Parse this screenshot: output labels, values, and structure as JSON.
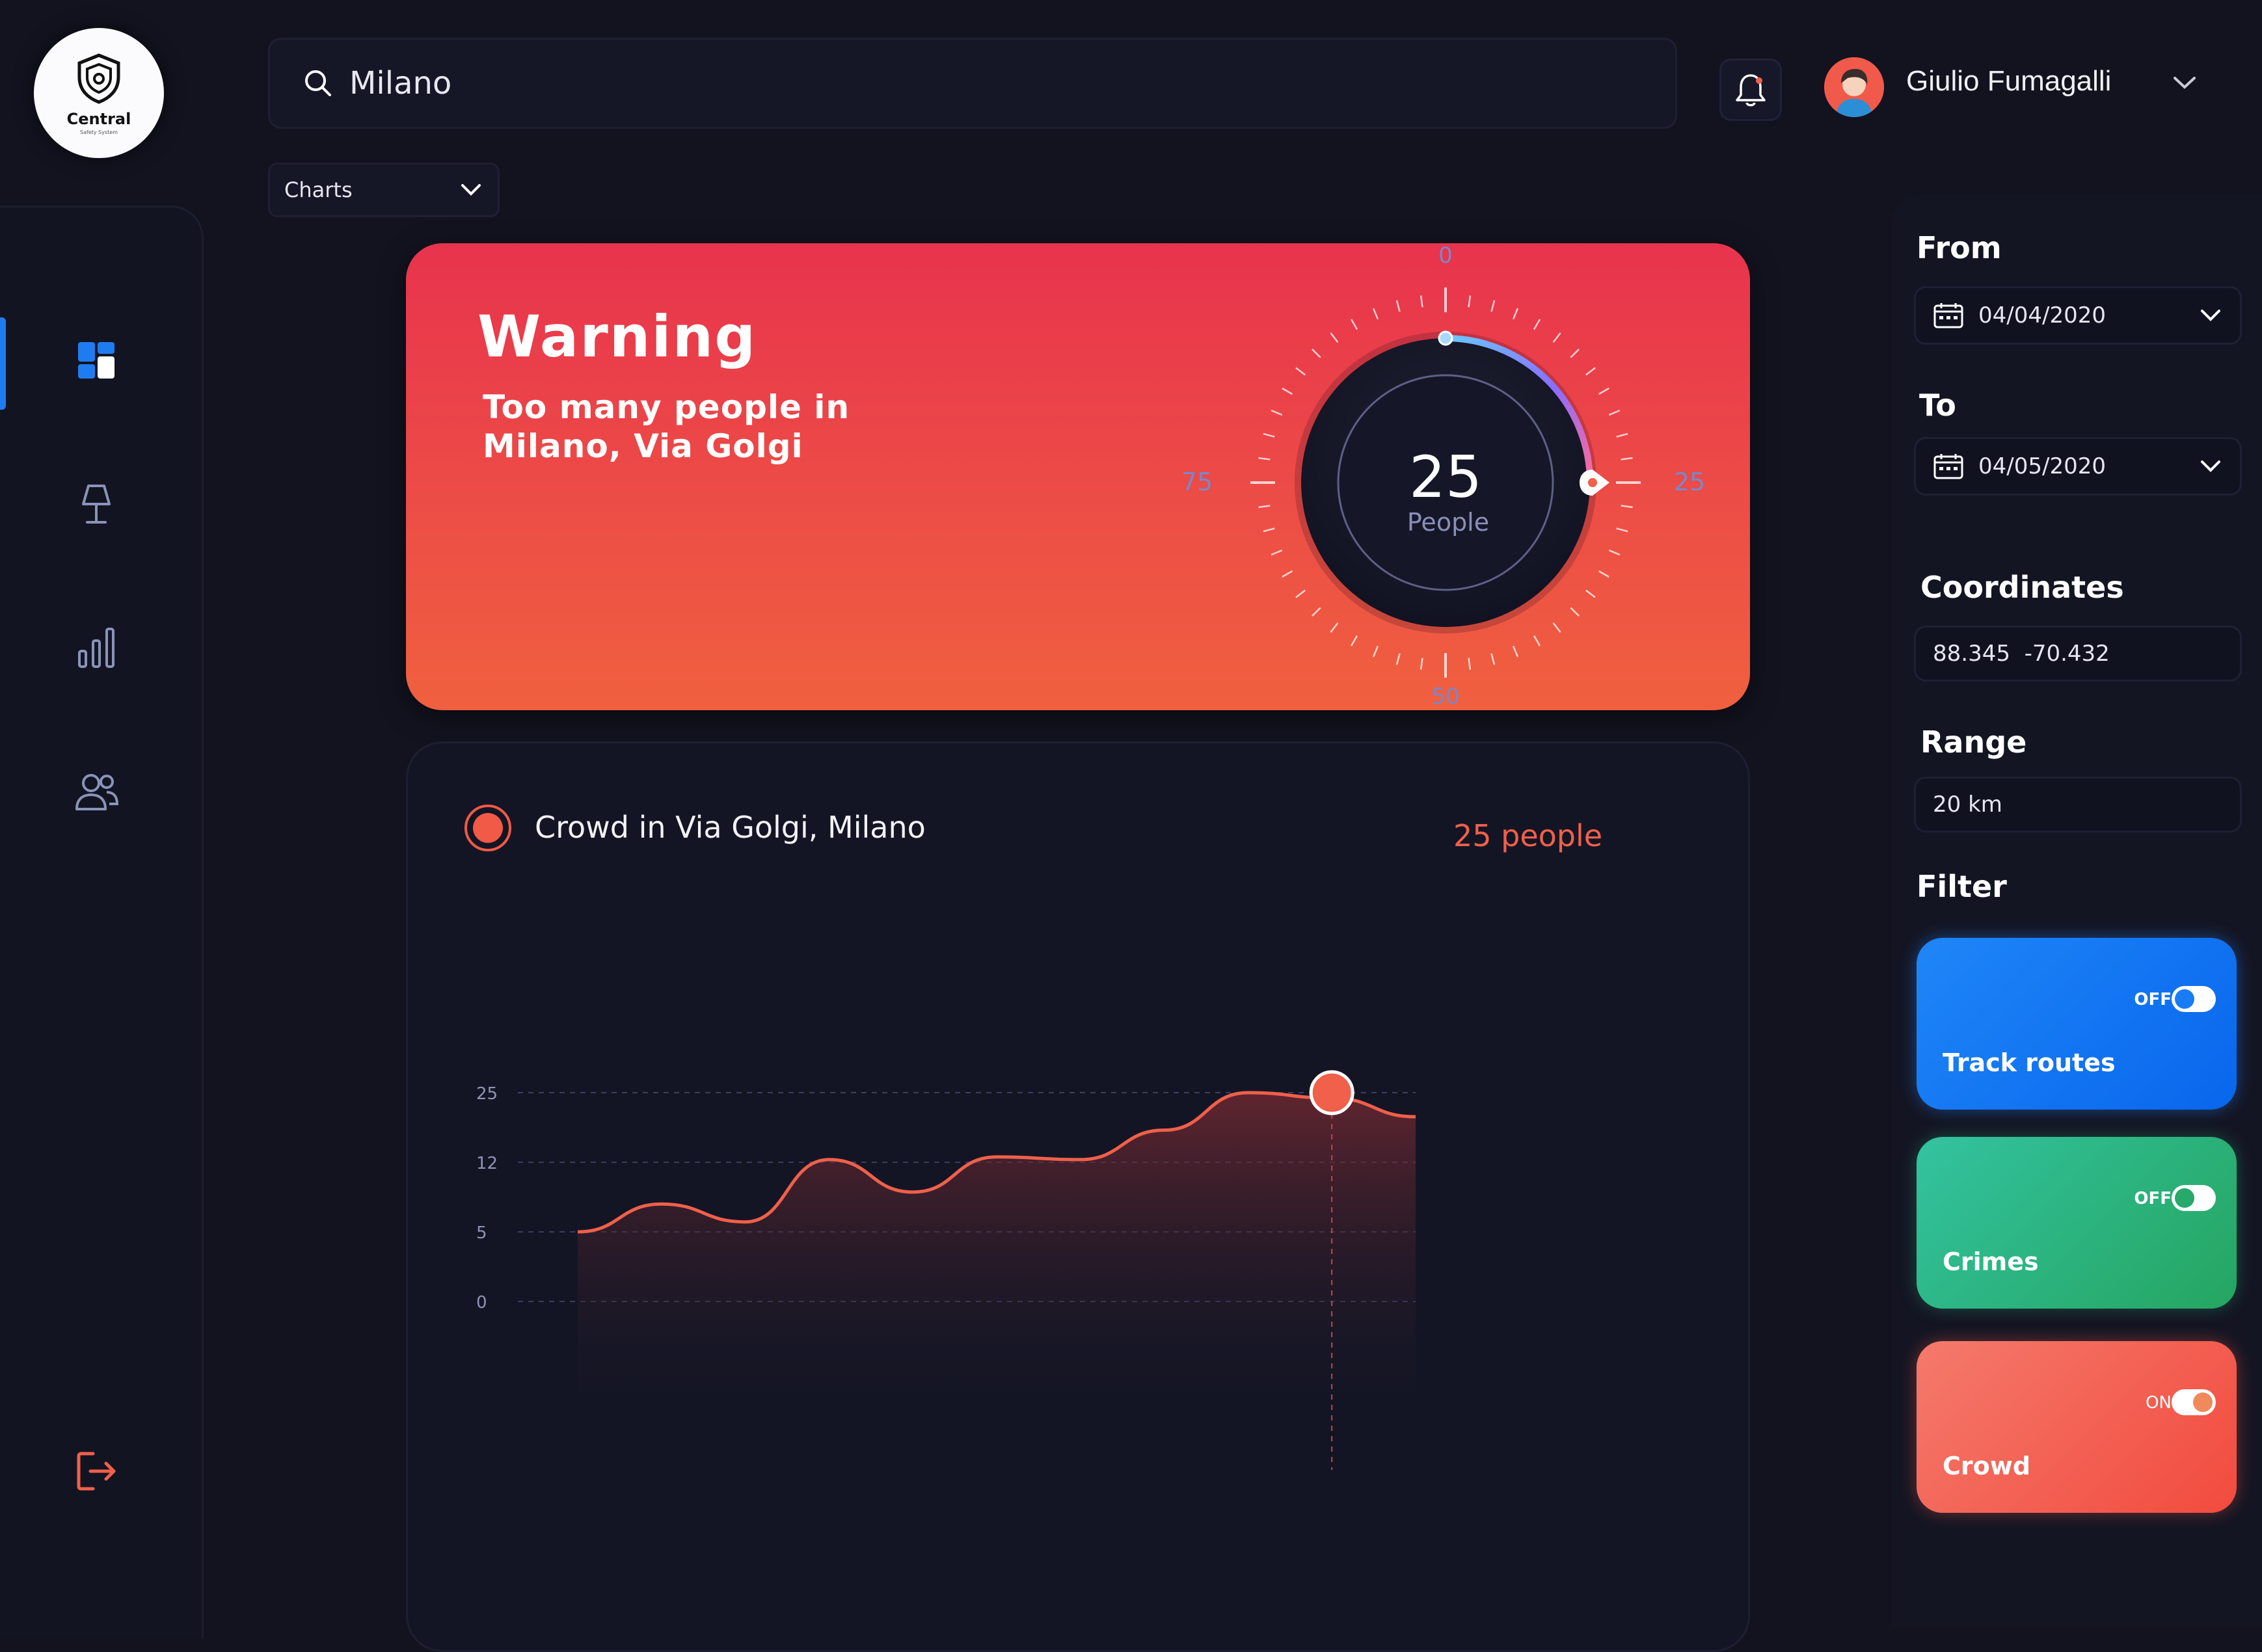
{
  "logo": {
    "name": "Central",
    "tagline": "Safety System"
  },
  "search": {
    "value": "Milano"
  },
  "user": {
    "name": "Giulio Fumagalli"
  },
  "view_select": {
    "value": "Charts"
  },
  "warning": {
    "title": "Warning",
    "message": "Too many people in Milano, Via Golgi",
    "gauge": {
      "value": "25",
      "unit": "People",
      "ticks": [
        "0",
        "25",
        "50",
        "75"
      ],
      "level": 25
    }
  },
  "chart_card": {
    "legend_label": "Crowd in Via Golgi, Milano",
    "current_value_label": "25 people"
  },
  "chart_data": {
    "type": "area",
    "ytick_labels": [
      "25",
      "12",
      "5",
      "0"
    ],
    "series": [
      {
        "values": [
          5,
          7.8,
          6,
          12.5,
          9,
          13,
          12.5,
          18,
          25,
          24,
          20.5
        ]
      }
    ],
    "highlight_point": {
      "index": 9,
      "value": 25
    }
  },
  "panel": {
    "from_label": "From",
    "from_value": "04/04/2020",
    "to_label": "To",
    "to_value": "04/05/2020",
    "coordinates_label": "Coordinates",
    "coordinates_value": "88.345  -70.432",
    "range_label": "Range",
    "range_value": "20 km",
    "filter_label": "Filter"
  },
  "filters": [
    {
      "title": "Track routes",
      "state": "OFF",
      "color": "#1a7cf5"
    },
    {
      "title": "Crimes",
      "state": "OFF",
      "color": "#2fb77a"
    },
    {
      "title": "Crowd",
      "state": "ON",
      "color": "#f0604a"
    }
  ],
  "colors": {
    "accent_blue": "#1f7cf0",
    "accent_red": "#f05a46",
    "background": "#12131f"
  }
}
